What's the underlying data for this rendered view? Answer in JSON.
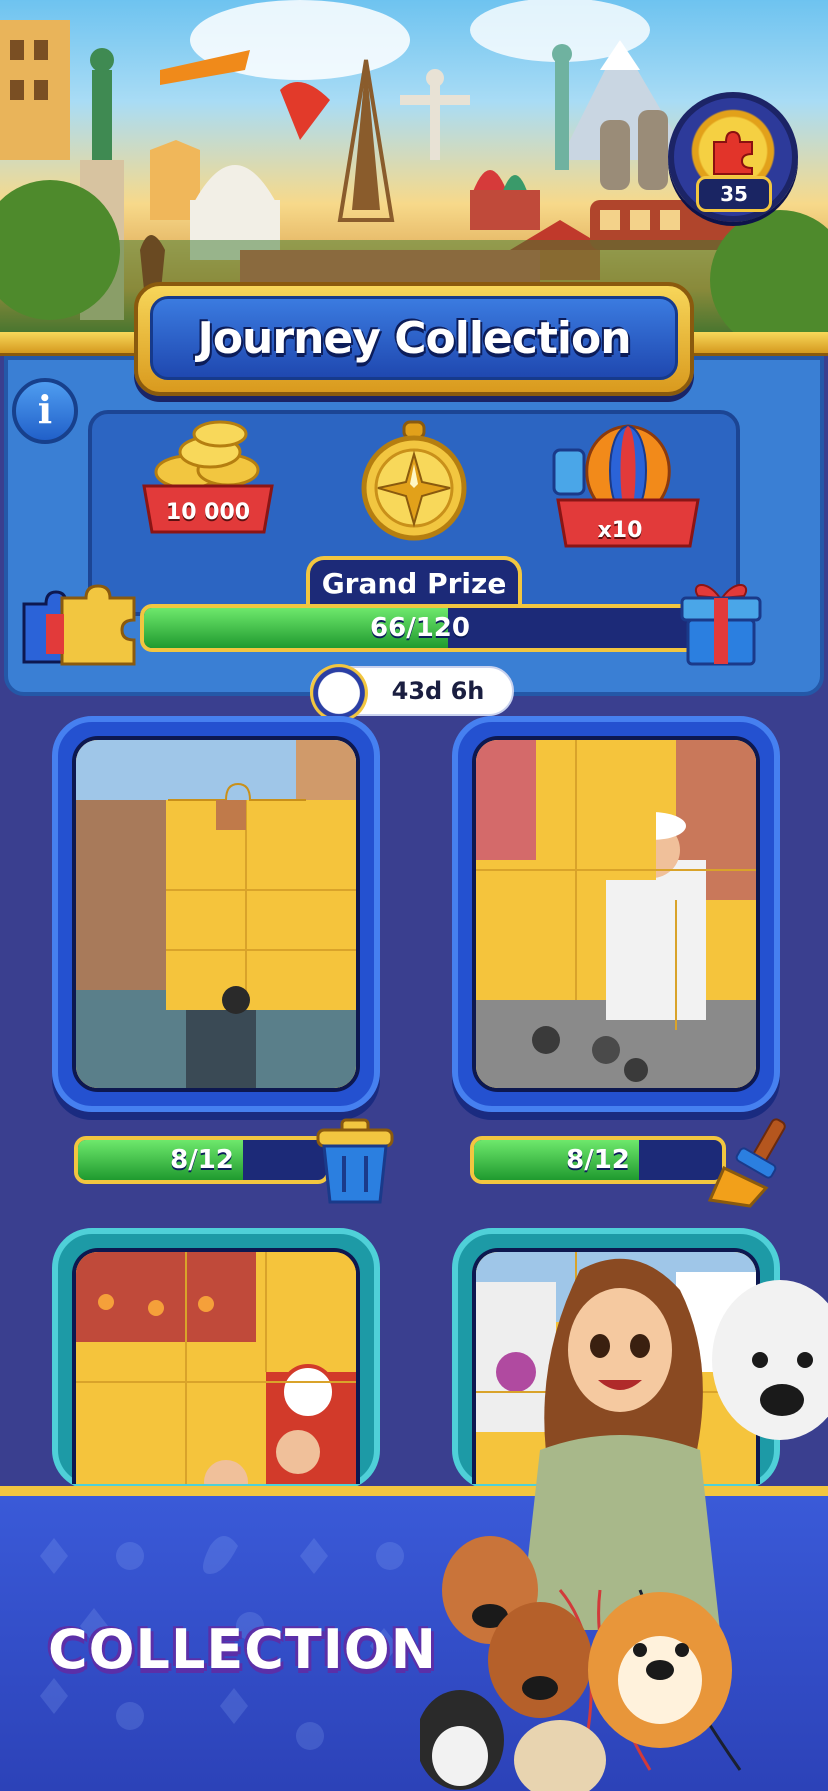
{
  "header": {
    "title": "Journey Collection",
    "badge_count": "35"
  },
  "rewards": {
    "coins_label": "10 000",
    "balloon_label": "x10",
    "grand_prize_label": "Grand Prize"
  },
  "journey_progress": {
    "label": "66/120",
    "current": 66,
    "total": 120
  },
  "timer": {
    "label": "43d 6h"
  },
  "puzzles": [
    {
      "progress_label": "8/12",
      "current": 8,
      "total": 12,
      "tool": "trash-can-icon"
    },
    {
      "progress_label": "8/12",
      "current": 8,
      "total": 12,
      "tool": "broom-icon"
    }
  ],
  "footer": {
    "label": "COLLECTION"
  },
  "colors": {
    "gold": "#f2c640",
    "panel_blue": "#3a7fd4",
    "progress_green": "#3fc24a",
    "dark_navy": "#1c2a78"
  }
}
